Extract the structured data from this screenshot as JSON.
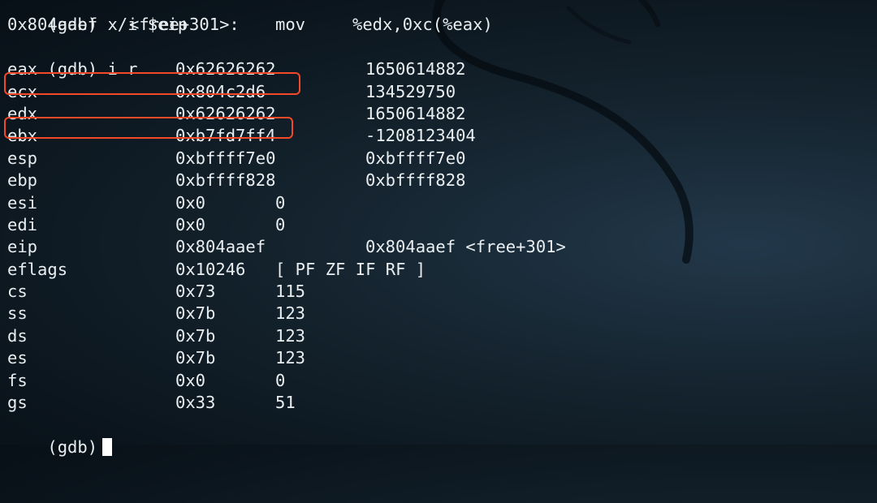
{
  "terminal": {
    "cmd1": {
      "prompt": "(gdb)",
      "command": "x/i $eip"
    },
    "disasm": {
      "address": "0x804aaef",
      "symbol": "<free+301>:",
      "mnemonic": "mov",
      "operands": "%edx,0xc(%eax)"
    },
    "cmd2": {
      "prompt": "(gdb)",
      "command": "i r"
    },
    "registers": [
      {
        "name": "eax",
        "hex": "0x62626262",
        "value": "1650614882"
      },
      {
        "name": "ecx",
        "hex": "0x804c2d6",
        "value": "134529750"
      },
      {
        "name": "edx",
        "hex": "0x62626262",
        "value": "1650614882"
      },
      {
        "name": "ebx",
        "hex": "0xb7fd7ff4",
        "value": "-1208123404"
      },
      {
        "name": "esp",
        "hex": "0xbffff7e0",
        "value": "0xbffff7e0"
      },
      {
        "name": "ebp",
        "hex": "0xbffff828",
        "value": "0xbffff828"
      },
      {
        "name": "esi",
        "hex": "0x0",
        "value": "0"
      },
      {
        "name": "edi",
        "hex": "0x0",
        "value": "0"
      },
      {
        "name": "eip",
        "hex": "0x804aaef",
        "value": "0x804aaef <free+301>"
      },
      {
        "name": "eflags",
        "hex": "0x10246",
        "value": "[ PF ZF IF RF ]"
      },
      {
        "name": "cs",
        "hex": "0x73",
        "value": "115"
      },
      {
        "name": "ss",
        "hex": "0x7b",
        "value": "123"
      },
      {
        "name": "ds",
        "hex": "0x7b",
        "value": "123"
      },
      {
        "name": "es",
        "hex": "0x7b",
        "value": "123"
      },
      {
        "name": "fs",
        "hex": "0x0",
        "value": "0"
      },
      {
        "name": "gs",
        "hex": "0x33",
        "value": "51"
      }
    ],
    "final_prompt": "(gdb)",
    "highlight_color": "#f24a28"
  }
}
